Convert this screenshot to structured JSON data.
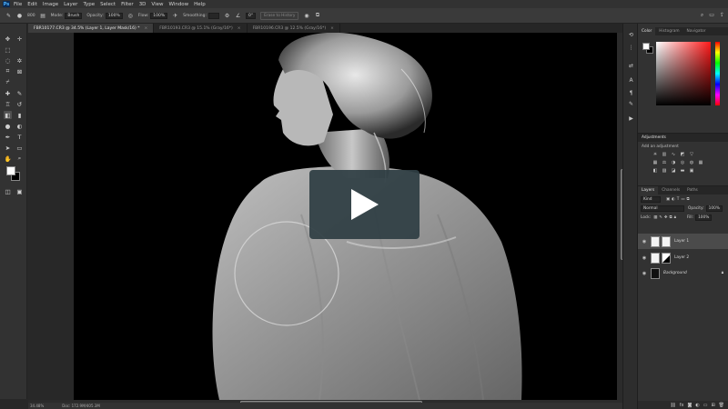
{
  "menubar": {
    "logo": "Ps",
    "items": [
      "File",
      "Edit",
      "Image",
      "Layer",
      "Type",
      "Select",
      "Filter",
      "3D",
      "View",
      "Window",
      "Help"
    ]
  },
  "options_bar": {
    "mode_label": "Mode:",
    "mode_value": "Brush",
    "opacity_label": "Opacity:",
    "opacity_value": "100%",
    "flow_label": "Flow:",
    "flow_value": "100%",
    "smoothing_label": "Smoothing:",
    "angle_value": "0°",
    "erase_history_label": "Erase to History",
    "brush_size": "800"
  },
  "doc_tabs": [
    {
      "title": "FBR10177.CR3 @ 34.5% (Layer 1, Layer Mask/16) *",
      "active": true
    },
    {
      "title": "FBR10193.CR3 @ 15.1% (Gray/16*)",
      "active": false
    },
    {
      "title": "FBR10196.CR3 @ 12.5% (Gray/16*)",
      "active": false
    }
  ],
  "status_bar": {
    "zoom": "34.48%",
    "doc_size": "Doc: 172.9M/405.3M"
  },
  "color_panel": {
    "tabs": [
      "Color",
      "Histogram",
      "Navigator"
    ],
    "active_tab": "Color",
    "fg_color": "#ffffff",
    "bg_color": "#000000"
  },
  "adjustments_panel": {
    "title": "Adjustments",
    "subtitle": "Add an adjustment"
  },
  "layers_panel": {
    "tabs": [
      "Layers",
      "Channels",
      "Paths"
    ],
    "active_tab": "Layers",
    "filter_kind": "Kind",
    "blend_mode": "Normal",
    "opacity_label": "Opacity:",
    "opacity_value": "100%",
    "lock_label": "Lock:",
    "fill_label": "Fill:",
    "fill_value": "100%",
    "layers": [
      {
        "name": "Layer 1",
        "selected": true
      },
      {
        "name": "Layer 2",
        "selected": false
      },
      {
        "name": "Background",
        "selected": false,
        "locked": true
      }
    ]
  },
  "colors": {
    "app_bg": "#282828",
    "panel_bg": "#323232",
    "play_overlay": "#2f3e44"
  }
}
